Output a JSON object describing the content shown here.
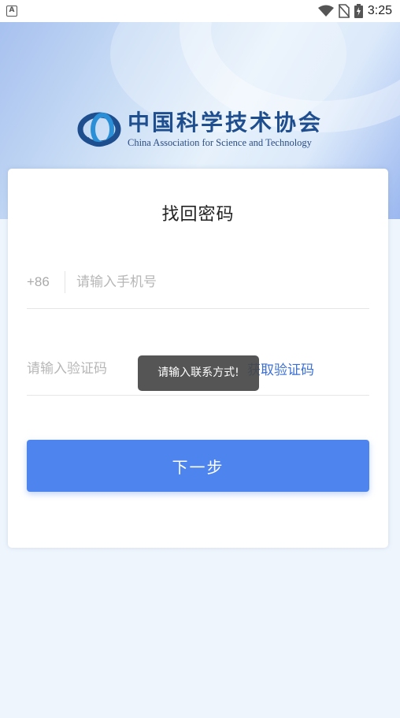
{
  "status_bar": {
    "time": "3:25",
    "notification_icon": "a-icon",
    "icons": [
      "wifi-icon",
      "no-sim-icon",
      "battery-charging-icon"
    ]
  },
  "logo": {
    "name_cn": "中国科学技术协会",
    "name_en": "China Association for Science and Technology",
    "colors": {
      "primary": "#1e4e8e",
      "accent": "#2a8fd6"
    }
  },
  "form": {
    "title": "找回密码",
    "country_code": "+86",
    "phone_placeholder": "请输入手机号",
    "code_placeholder": "请输入验证码",
    "get_code_label": "获取验证码",
    "next_label": "下一步"
  },
  "toast": {
    "message": "请输入联系方式!"
  },
  "colors": {
    "button": "#4d84ee",
    "link": "#3b6fd6",
    "background": "#eef5fd"
  }
}
